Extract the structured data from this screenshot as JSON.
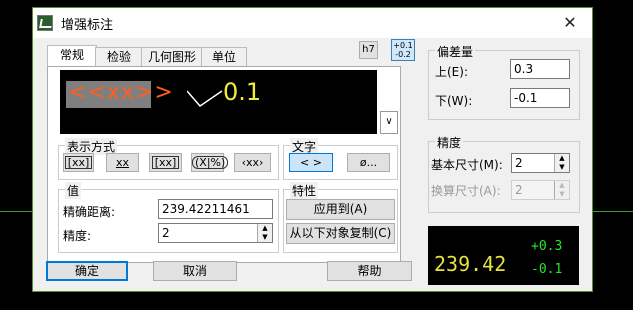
{
  "dialog": {
    "title": "增强标注",
    "close": "✕"
  },
  "tabs": [
    {
      "label": "常规"
    },
    {
      "label": "检验"
    },
    {
      "label": "几何图形"
    },
    {
      "label": "单位"
    }
  ],
  "toolbar": {
    "h7": "h7",
    "tol_top": "+0.1",
    "tol_bottom": "-0.2"
  },
  "preview": {
    "text": "<<xx>>",
    "value": "0.1"
  },
  "display_mode": {
    "label": "表示方式",
    "buttons": [
      "[xx]",
      "xx",
      "[xx]",
      "(X|%)",
      "‹xx›"
    ]
  },
  "text_group": {
    "label": "文字",
    "btn1": "< >",
    "btn2": "ø..."
  },
  "value_group": {
    "label": "值",
    "exact_label": "精确距离:",
    "exact_value": "239.42211461",
    "precision_label": "精度:",
    "precision_value": "2"
  },
  "property_group": {
    "label": "特性",
    "apply_btn": "应用到(A)",
    "copy_btn": "从以下对象复制(C)"
  },
  "deviation": {
    "label": "偏差量",
    "upper_label": "上(E):",
    "upper_value": "0.3",
    "lower_label": "下(W):",
    "lower_value": "-0.1"
  },
  "precision": {
    "label": "精度",
    "basic_label": "基本尺寸(M):",
    "basic_value": "2",
    "alt_label": "换算尺寸(A):",
    "alt_value": "2"
  },
  "footer": {
    "ok": "确定",
    "cancel": "取消",
    "help": "帮助"
  },
  "dim_preview": {
    "main": "239.42",
    "upper": "+0.3",
    "lower": "-0.1"
  }
}
